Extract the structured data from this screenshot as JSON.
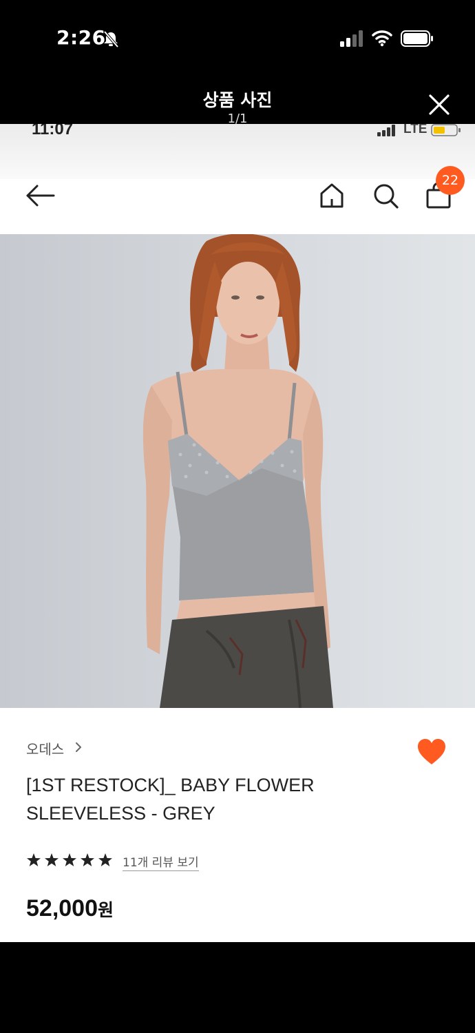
{
  "os_status": {
    "time": "2:26"
  },
  "viewer": {
    "title": "상품 사진",
    "counter": "1/1"
  },
  "inner_status": {
    "time": "11:07",
    "network": "LTE"
  },
  "app_bar": {
    "cart_count": "22"
  },
  "product": {
    "brand": "오데스",
    "title": "[1ST RESTOCK]_ BABY FLOWER SLEEVELESS - GREY",
    "rating_stars": 5,
    "reviews_link": "11개 리뷰 보기",
    "price": "52,000",
    "price_unit": "원",
    "wishlisted": true
  },
  "colors": {
    "accent": "#ff5a1f",
    "text": "#222222"
  }
}
